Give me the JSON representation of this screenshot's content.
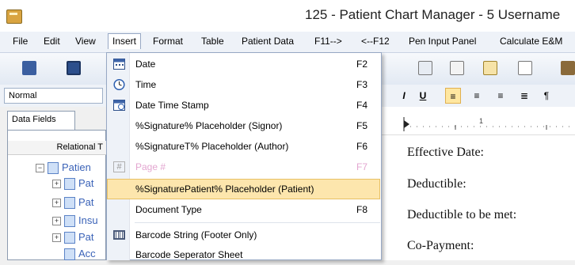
{
  "window": {
    "title": "125 - Patient Chart Manager - 5  Username"
  },
  "menubar": {
    "items": [
      "File",
      "Edit",
      "View",
      "Insert",
      "Format",
      "Table",
      "Patient Data",
      "F11-->",
      "<--F12",
      "Pen Input Panel",
      "Calculate E&M"
    ],
    "active": "Insert"
  },
  "formatbar": {
    "style_value": "Normal"
  },
  "leftpane": {
    "tab_label": "Data Fields",
    "tree_header": "Relational T",
    "tree_items": [
      "Patien",
      "Pat",
      "Pat",
      "Insu",
      "Pat",
      "Acc"
    ]
  },
  "document": {
    "lines": [
      "Effective Date:",
      "Deductible:",
      "Deductible to be met:",
      "Co-Payment:"
    ]
  },
  "insert_menu": {
    "items": [
      {
        "label": "Date",
        "shortcut": "F2",
        "icon": "calendar-icon"
      },
      {
        "label": "Time",
        "shortcut": "F3",
        "icon": "clock-icon"
      },
      {
        "label": "Date Time Stamp",
        "shortcut": "F4",
        "icon": "datetime-icon"
      },
      {
        "label": "%Signature% Placeholder (Signor)",
        "shortcut": "F5",
        "icon": ""
      },
      {
        "label": "%SignatureT% Placeholder (Author)",
        "shortcut": "F6",
        "icon": ""
      },
      {
        "label": "Page #",
        "shortcut": "F7",
        "icon": "page-number-icon",
        "disabled": true
      },
      {
        "label": "%SignaturePatient% Placeholder (Patient)",
        "shortcut": "",
        "icon": "",
        "highlighted": true
      },
      {
        "label": "Document Type",
        "shortcut": "F8",
        "icon": ""
      },
      {
        "label": "Barcode String (Footer Only)",
        "shortcut": "",
        "icon": "barcode-icon"
      },
      {
        "label": "Barcode Seperator Sheet",
        "shortcut": "",
        "icon": ""
      }
    ]
  },
  "colors": {
    "highlight": "#fde6ad",
    "disabled_text": "#e3a6d0",
    "tree_text": "#3b63b8"
  }
}
